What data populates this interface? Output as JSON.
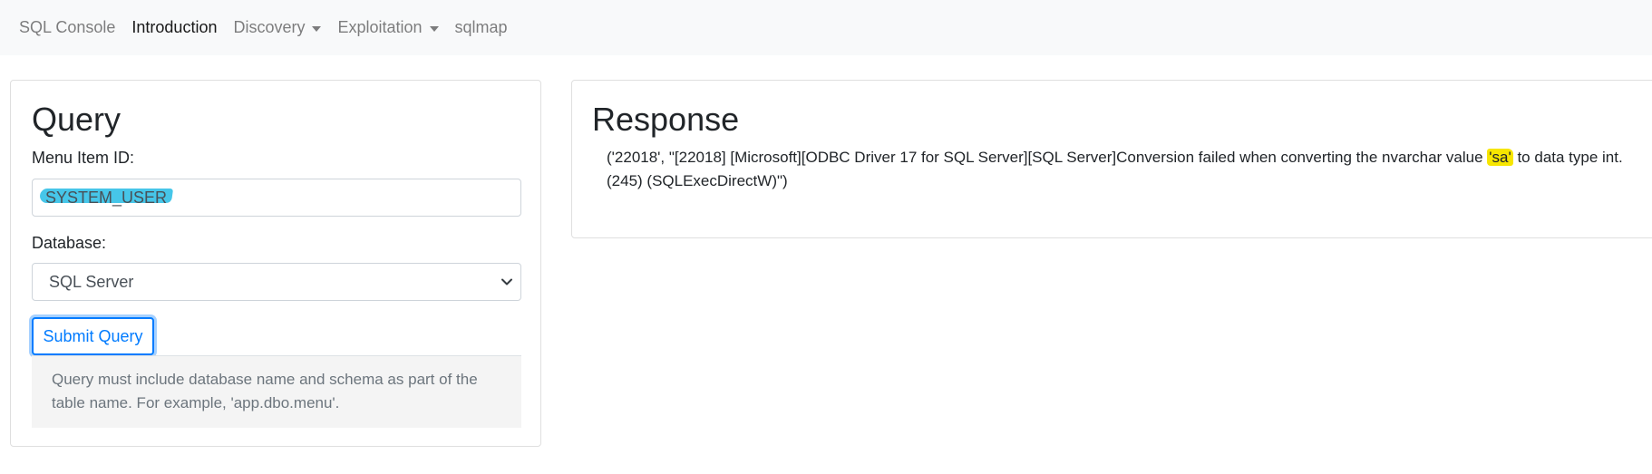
{
  "navbar": {
    "items": [
      {
        "label": "SQL Console",
        "active": false,
        "dropdown": false
      },
      {
        "label": "Introduction",
        "active": true,
        "dropdown": false
      },
      {
        "label": "Discovery",
        "active": false,
        "dropdown": true
      },
      {
        "label": "Exploitation",
        "active": false,
        "dropdown": true
      },
      {
        "label": "sqlmap",
        "active": false,
        "dropdown": false
      }
    ]
  },
  "query": {
    "title": "Query",
    "menu_item_label": "Menu Item ID:",
    "menu_item_value": "SYSTEM_USER",
    "database_label": "Database:",
    "database_selected": "SQL Server",
    "submit_label": "Submit Query",
    "note": "Query must include database name and schema as part of the table name. For example, 'app.dbo.menu'."
  },
  "response": {
    "title": "Response",
    "text_before": "('22018', \"[22018] [Microsoft][ODBC Driver 17 for SQL Server][SQL Server]Conversion failed when converting the nvarchar value ",
    "text_highlight": "'sa'",
    "text_after": " to data type int. (245) (SQLExecDirectW)\")"
  },
  "colors": {
    "navbar_bg": "#f8f9fa",
    "primary": "#007bff",
    "input_highlight": "#3cc3e8",
    "response_highlight": "#f7e600"
  },
  "icons": {
    "select_chevron": "chevron-down-icon",
    "nav_caret": "caret-down-icon"
  }
}
